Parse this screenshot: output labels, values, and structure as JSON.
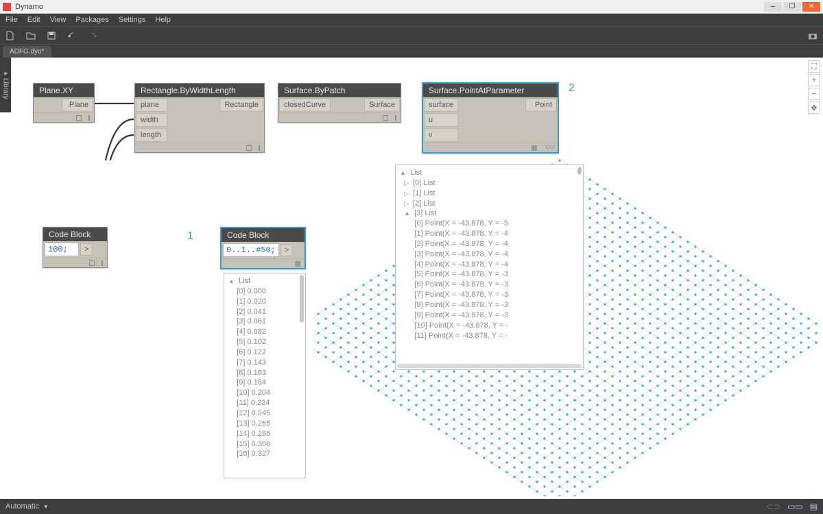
{
  "app": {
    "title": "Dynamo"
  },
  "menu": [
    "File",
    "Edit",
    "View",
    "Packages",
    "Settings",
    "Help"
  ],
  "tab": "ADFG.dyn*",
  "sidebar": "Library",
  "statusbar": {
    "mode": "Automatic"
  },
  "annotations": {
    "a1": "1",
    "a2": "2"
  },
  "nodes": {
    "plane": {
      "title": "Plane.XY",
      "out": "Plane"
    },
    "rect": {
      "title": "Rectangle.ByWidthLength",
      "in": [
        "plane",
        "width",
        "length"
      ],
      "out": "Rectangle"
    },
    "patch": {
      "title": "Surface.ByPatch",
      "in": "closedCurve",
      "out": "Surface"
    },
    "param": {
      "title": "Surface.PointAtParameter",
      "in": [
        "surface",
        "u",
        "v"
      ],
      "out": "Point",
      "lace": "XXX"
    },
    "code1": {
      "title": "Code Block",
      "text": "100;",
      "out": ">"
    },
    "code2": {
      "title": "Code Block",
      "text": "0..1..#50;",
      "out": ">"
    }
  },
  "popup1": {
    "head": "List",
    "items": [
      "[0] 0.000",
      "[1] 0.020",
      "[2] 0.041",
      "[3] 0.061",
      "[4] 0.082",
      "[5] 0.102",
      "[6] 0.122",
      "[7] 0.143",
      "[8] 0.163",
      "[9] 0.184",
      "[10] 0.204",
      "[11] 0.224",
      "[12] 0.245",
      "[13] 0.265",
      "[14] 0.286",
      "[15] 0.306",
      "[16] 0.327"
    ]
  },
  "popup2": {
    "head": "List",
    "groups": [
      "[0] List",
      "[1] List",
      "[2] List",
      "[3] List"
    ],
    "items": [
      "[0] Point(X = -43.878, Y = -5",
      "[1] Point(X = -43.878, Y = -4",
      "[2] Point(X = -43.878, Y = -4",
      "[3] Point(X = -43.878, Y = -4",
      "[4] Point(X = -43.878, Y = -4",
      "[5] Point(X = -43.878, Y = -3",
      "[6] Point(X = -43.878, Y = -3",
      "[7] Point(X = -43.878, Y = -3",
      "[8] Point(X = -43.878, Y = -3",
      "[9] Point(X = -43.878, Y = -3",
      "[10] Point(X = -43.878, Y = -",
      "[11] Point(X = -43.878, Y = -"
    ]
  }
}
